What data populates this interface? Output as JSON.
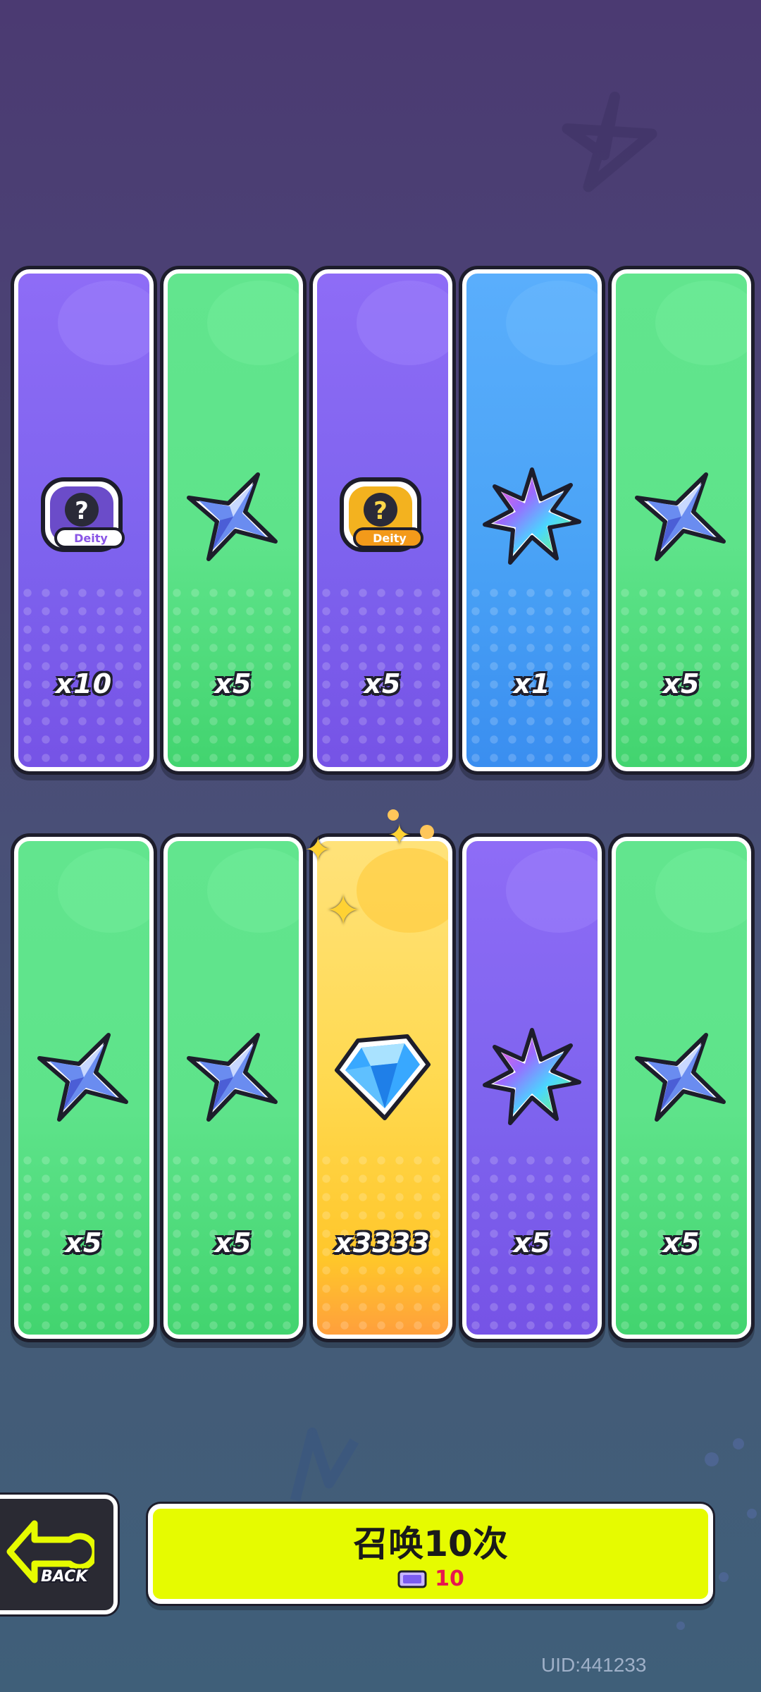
{
  "rows": [
    [
      {
        "item": "deity-ticket-purple",
        "count": "x10",
        "color": "purple"
      },
      {
        "item": "blue-star-crystal",
        "count": "x5",
        "color": "green"
      },
      {
        "item": "deity-ticket-gold",
        "count": "x5",
        "color": "purple"
      },
      {
        "item": "rainbow-leaf",
        "count": "x1",
        "color": "blue"
      },
      {
        "item": "blue-star-crystal",
        "count": "x5",
        "color": "green"
      }
    ],
    [
      {
        "item": "blue-star-crystal",
        "count": "x5",
        "color": "green"
      },
      {
        "item": "blue-star-crystal",
        "count": "x5",
        "color": "green"
      },
      {
        "item": "diamond",
        "count": "x3333",
        "color": "yellow"
      },
      {
        "item": "rainbow-leaf",
        "count": "x5",
        "color": "purple"
      },
      {
        "item": "blue-star-crystal",
        "count": "x5",
        "color": "green"
      }
    ]
  ],
  "ticket_label": "Deity",
  "back_button": {
    "label": "BACK"
  },
  "summon_button": {
    "label": "召唤10次",
    "cost": "10"
  },
  "uid": "UID:441233",
  "colors": {
    "button": "#e6fb00",
    "cost": "#e8174e"
  }
}
